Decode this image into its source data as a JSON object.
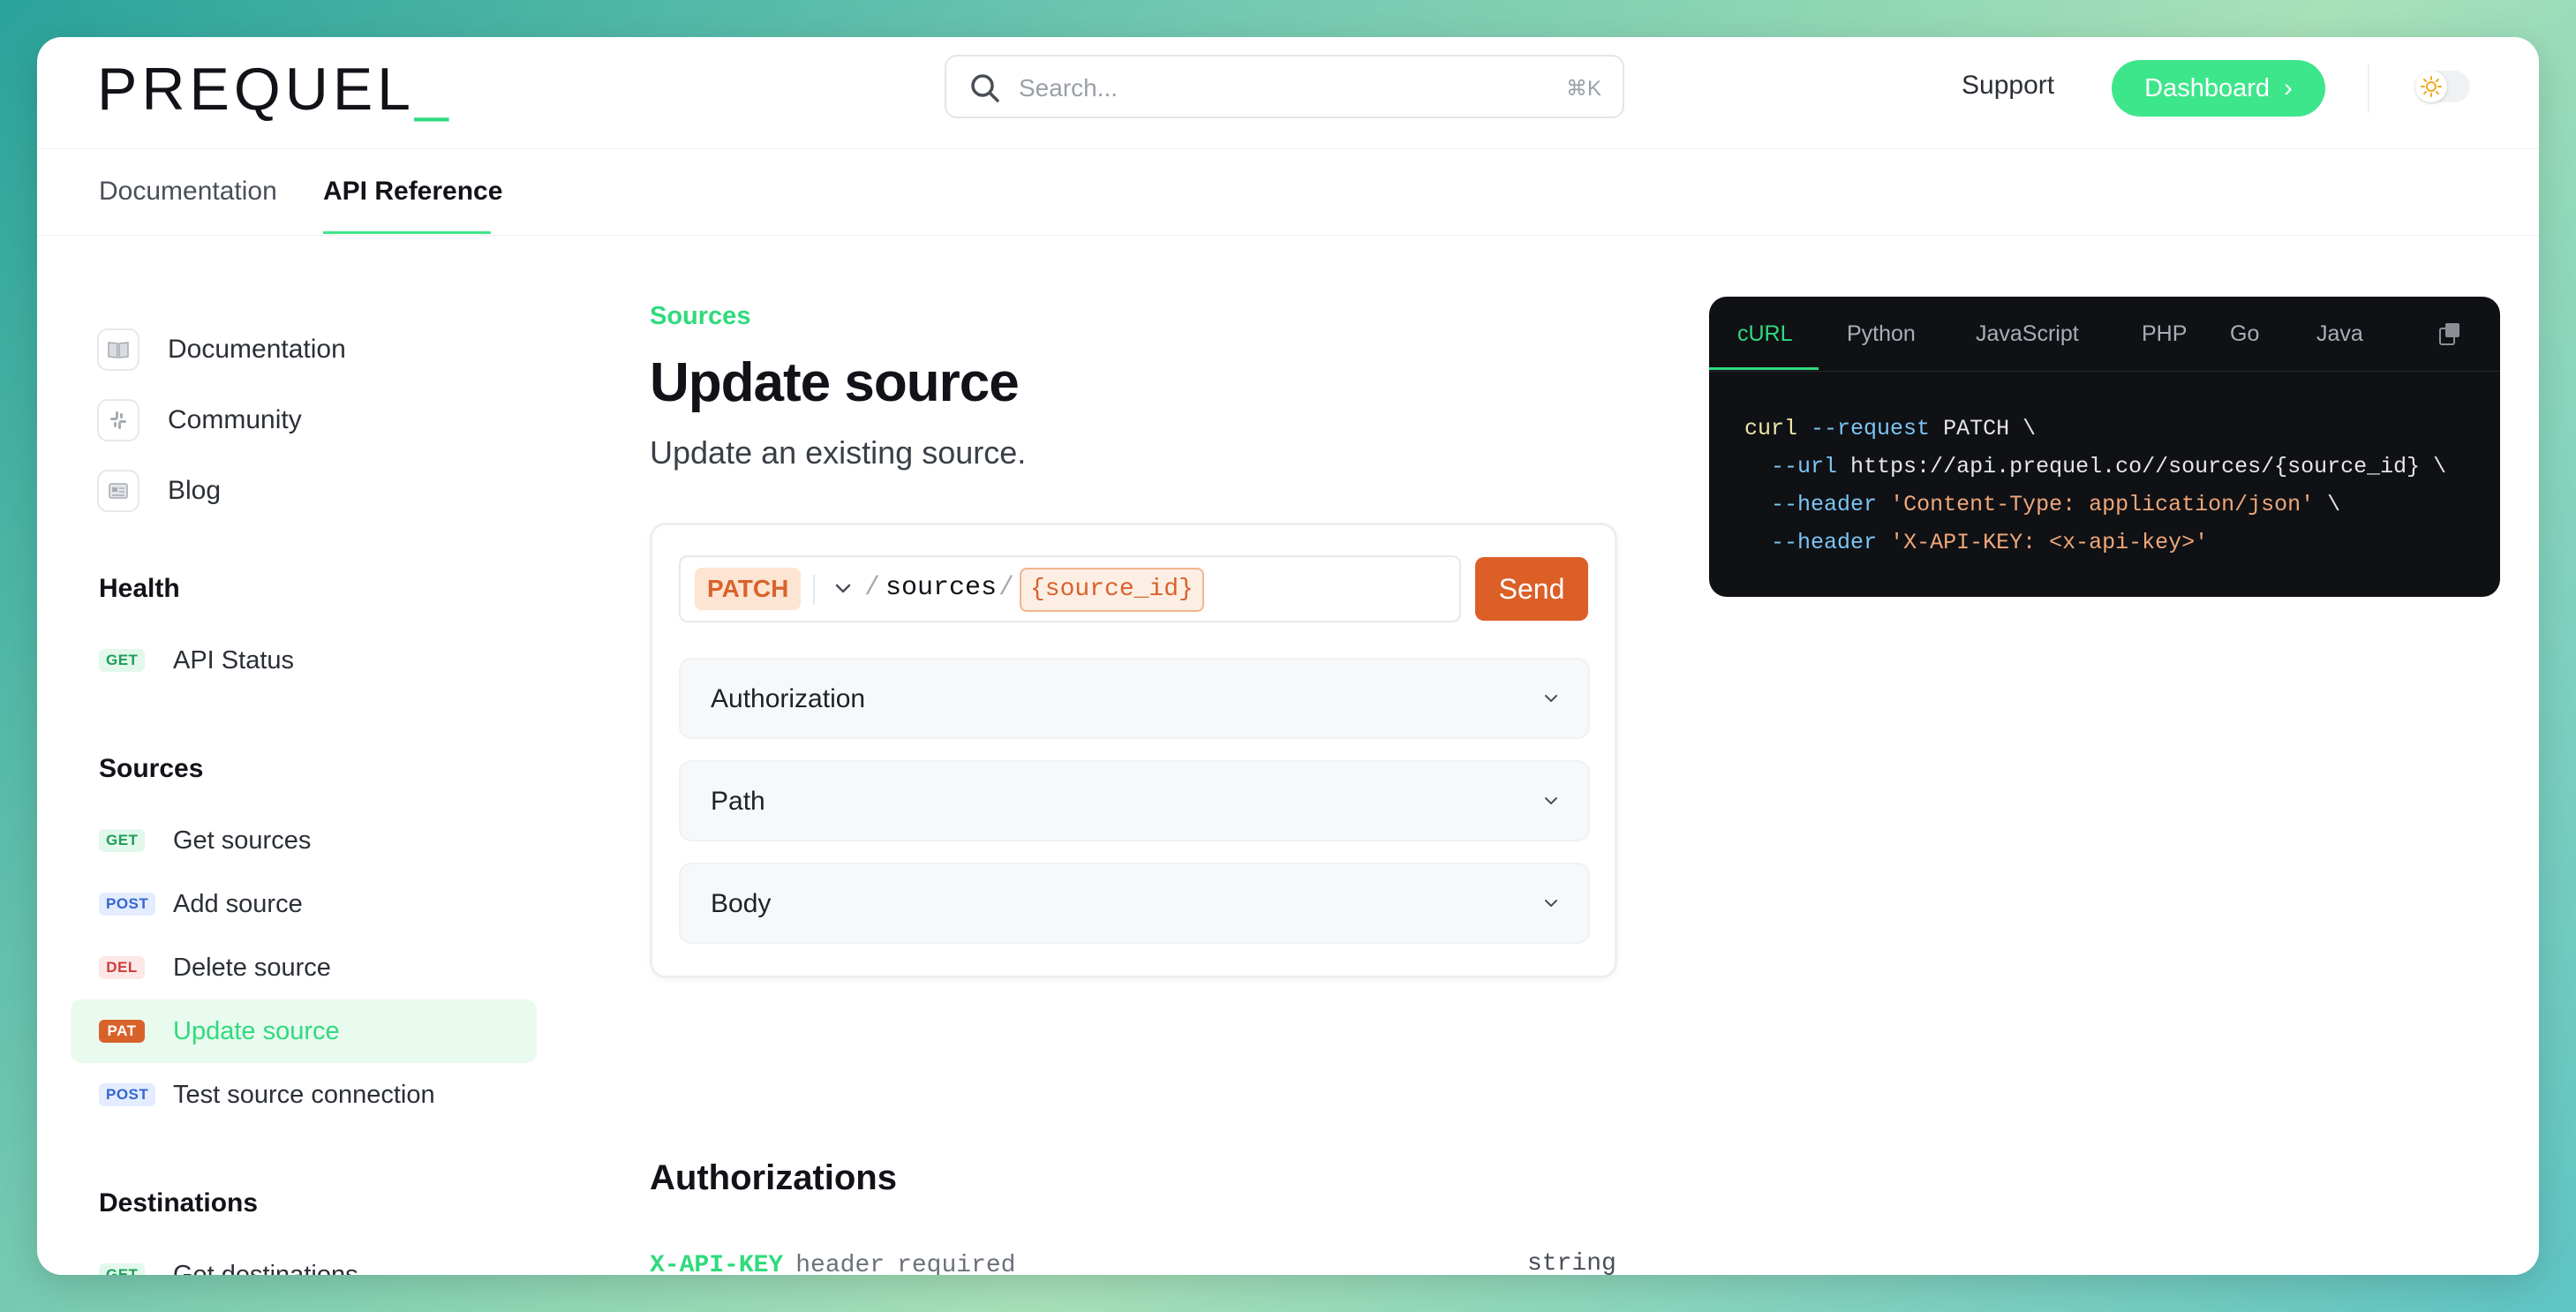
{
  "header": {
    "logo": "PREQUEL",
    "logo_cursor": "_",
    "search_placeholder": "Search...",
    "search_shortcut": "⌘K",
    "support_label": "Support",
    "dashboard_label": "Dashboard",
    "dashboard_arrow": "›"
  },
  "tabs": [
    {
      "label": "Documentation"
    },
    {
      "label": "API Reference"
    }
  ],
  "sidebar": {
    "links": [
      {
        "label": "Documentation",
        "icon": "book-icon"
      },
      {
        "label": "Community",
        "icon": "slack-icon"
      },
      {
        "label": "Blog",
        "icon": "newspaper-icon"
      }
    ],
    "sections": [
      {
        "title": "Health",
        "items": [
          {
            "method": "GET",
            "label": "API Status"
          }
        ]
      },
      {
        "title": "Sources",
        "items": [
          {
            "method": "GET",
            "label": "Get sources"
          },
          {
            "method": "POST",
            "label": "Add source"
          },
          {
            "method": "DEL",
            "label": "Delete source"
          },
          {
            "method": "PAT",
            "label": "Update source"
          },
          {
            "method": "POST",
            "label": "Test source connection"
          }
        ]
      },
      {
        "title": "Destinations",
        "items": [
          {
            "method": "GET",
            "label": "Get destinations"
          }
        ]
      }
    ]
  },
  "main": {
    "breadcrumb": "Sources",
    "title": "Update source",
    "subtitle": "Update an existing source.",
    "playground": {
      "method": "PATCH",
      "slash": "/",
      "segment": "sources",
      "param": "{source_id}",
      "send_label": "Send",
      "sections": [
        {
          "label": "Authorization"
        },
        {
          "label": "Path"
        },
        {
          "label": "Body"
        }
      ]
    },
    "authorizations": {
      "title": "Authorizations",
      "key": "X-API-KEY",
      "location": "header",
      "required": "required",
      "type": "string"
    }
  },
  "code_panel": {
    "tabs": [
      "cURL",
      "Python",
      "JavaScript",
      "PHP",
      "Go",
      "Java"
    ],
    "lines": [
      {
        "cmd": "curl",
        "flag": "--request",
        "rest": "PATCH \\"
      },
      {
        "flag": "--url",
        "rest": "https://api.prequel.co//sources/{source_id} \\"
      },
      {
        "flag": "--header",
        "str": "'Content-Type: application/json'",
        "rest": "\\"
      },
      {
        "flag": "--header",
        "str": "'X-API-KEY: <x-api-key>'"
      }
    ]
  },
  "colors": {
    "accent": "#3ee68b",
    "patch": "#dc5f27",
    "code_bg": "#0f1115"
  }
}
